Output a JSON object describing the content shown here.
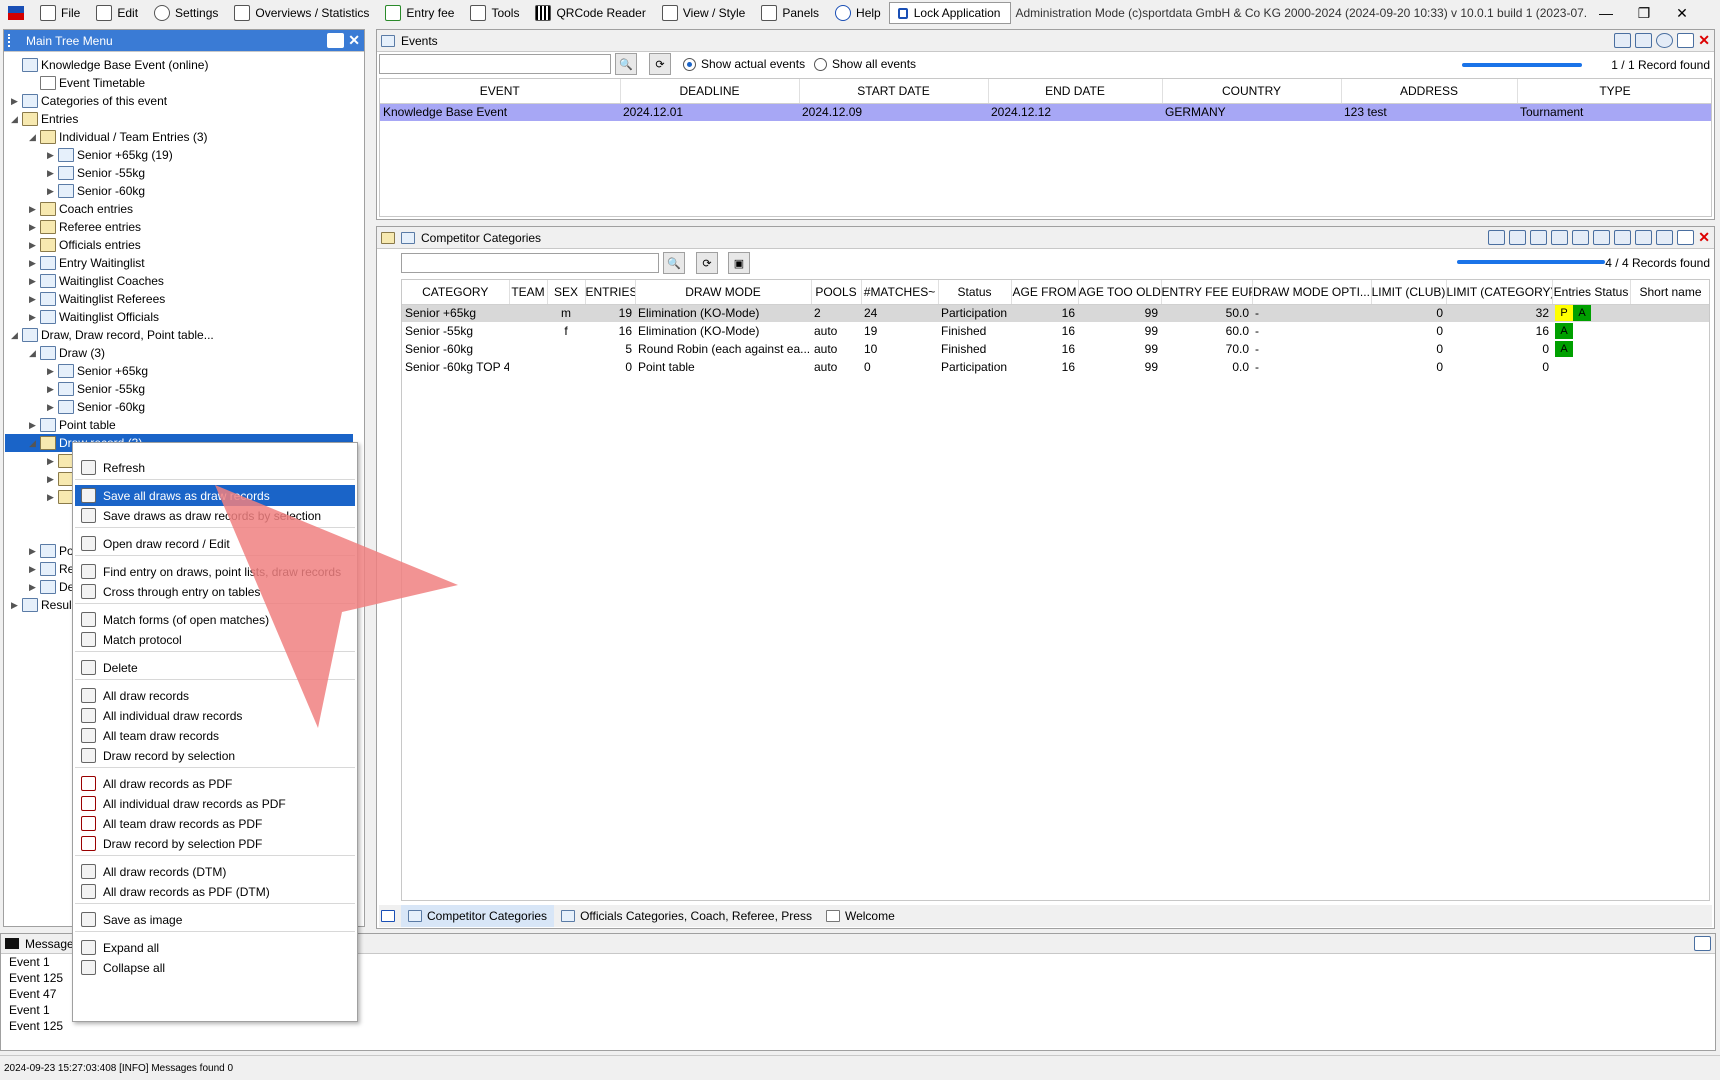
{
  "menubar": {
    "items": [
      {
        "label": "File",
        "icon": "file-icon"
      },
      {
        "label": "Edit",
        "icon": "edit-icon"
      },
      {
        "label": "Settings",
        "icon": "gear-icon"
      },
      {
        "label": "Overviews / Statistics",
        "icon": "overview-icon"
      },
      {
        "label": "Entry fee",
        "icon": "fee-icon"
      },
      {
        "label": "Tools",
        "icon": "tools-icon"
      },
      {
        "label": "QRCode Reader",
        "icon": "qrcode-icon"
      },
      {
        "label": "View / Style",
        "icon": "view-icon"
      },
      {
        "label": "Panels",
        "icon": "panels-icon"
      },
      {
        "label": "Help",
        "icon": "help-icon"
      }
    ],
    "lock_label": "Lock Application",
    "app_title": "Administration Mode (c)sportdata GmbH & Co KG 2000-2024 (2024-09-20 10:33)  v 10.0.1 build 1 (2023-07..."
  },
  "tree": {
    "title": "Main Tree Menu",
    "items": [
      {
        "label": "Knowledge Base Event (online)"
      },
      {
        "label": "Event Timetable"
      },
      {
        "label": "Categories of this event"
      },
      {
        "label": "Entries"
      },
      {
        "label": "Individual / Team Entries (3)"
      },
      {
        "label": "Senior +65kg (19)"
      },
      {
        "label": "Senior -55kg"
      },
      {
        "label": "Senior -60kg"
      },
      {
        "label": "Coach entries"
      },
      {
        "label": "Referee entries"
      },
      {
        "label": "Officials entries"
      },
      {
        "label": "Entry Waitinglist"
      },
      {
        "label": "Waitinglist Coaches"
      },
      {
        "label": "Waitinglist Referees"
      },
      {
        "label": "Waitinglist Officials"
      },
      {
        "label": "Draw, Draw record, Point table..."
      },
      {
        "label": "Draw (3)"
      },
      {
        "label": "Senior +65kg"
      },
      {
        "label": "Senior -55kg"
      },
      {
        "label": "Senior -60kg"
      },
      {
        "label": "Point table"
      },
      {
        "label": "Draw record (3)"
      },
      {
        "label": "Po"
      },
      {
        "label": "Re"
      },
      {
        "label": "De"
      },
      {
        "label": "Resul"
      }
    ]
  },
  "events": {
    "title": "Events",
    "radio_actual": "Show actual events",
    "radio_all": "Show all events",
    "records_found": "1 / 1 Record found",
    "columns": [
      "EVENT",
      "DEADLINE",
      "START DATE",
      "END DATE",
      "COUNTRY",
      "ADDRESS",
      "TYPE"
    ],
    "rows": [
      [
        "Knowledge Base Event",
        "2024.12.01",
        "2024.12.09",
        "2024.12.12",
        "GERMANY",
        "123 test",
        "Tournament"
      ]
    ]
  },
  "categories": {
    "title": "Competitor Categories",
    "records_found": "4 / 4 Records found",
    "columns": [
      "CATEGORY",
      "TEAM",
      "SEX",
      "ENTRIES",
      "DRAW MODE",
      "POOLS",
      "#MATCHES~",
      "Status",
      "AGE FROM",
      "AGE TOO OLD",
      "ENTRY FEE EUR",
      "DRAW MODE OPTI...",
      "LIMIT (CLUB)",
      "LIMIT (CATEGORY)",
      "Entries Status",
      "Short name"
    ],
    "rows": [
      {
        "category": "Senior +65kg",
        "team": "",
        "sex": "m",
        "entries": "19",
        "draw_mode": "Elimination (KO-Mode)",
        "pools": "2",
        "matches": "24",
        "status": "Participation",
        "age_from": "16",
        "age_too_old": "99",
        "fee": "50.0",
        "draw_opt": "-",
        "limit_club": "0",
        "limit_cat": "32",
        "badges": [
          "P",
          "A"
        ]
      },
      {
        "category": "Senior -55kg",
        "team": "",
        "sex": "f",
        "entries": "16",
        "draw_mode": "Elimination (KO-Mode)",
        "pools": "auto",
        "matches": "19",
        "status": "Finished",
        "age_from": "16",
        "age_too_old": "99",
        "fee": "60.0",
        "draw_opt": "-",
        "limit_club": "0",
        "limit_cat": "16",
        "badges": [
          "A"
        ]
      },
      {
        "category": "Senior -60kg",
        "team": "",
        "sex": "",
        "entries": "5",
        "draw_mode": "Round Robin (each against ea...",
        "pools": "auto",
        "matches": "10",
        "status": "Finished",
        "age_from": "16",
        "age_too_old": "99",
        "fee": "70.0",
        "draw_opt": "-",
        "limit_club": "0",
        "limit_cat": "0",
        "badges": [
          "A"
        ]
      },
      {
        "category": "Senior -60kg TOP 4",
        "team": "",
        "sex": "",
        "entries": "0",
        "draw_mode": "Point table",
        "pools": "auto",
        "matches": "0",
        "status": "Participation",
        "age_from": "16",
        "age_too_old": "99",
        "fee": "0.0",
        "draw_opt": "-",
        "limit_club": "0",
        "limit_cat": "0",
        "badges": []
      }
    ],
    "tabs": [
      "Competitor Categories",
      "Officials Categories, Coach, Referee, Press",
      "Welcome"
    ]
  },
  "context_menu": {
    "items": [
      {
        "label": "Refresh"
      },
      {
        "label": "Save all draws as draw records"
      },
      {
        "label": "Save draws as draw records by selection"
      },
      {
        "label": "Open draw record / Edit"
      },
      {
        "label": "Find entry on draws, point lists, draw records"
      },
      {
        "label": "Cross through entry on tables"
      },
      {
        "label": "Match forms (of open matches)"
      },
      {
        "label": "Match protocol"
      },
      {
        "label": "Delete"
      },
      {
        "label": "All draw records"
      },
      {
        "label": "All individual draw records"
      },
      {
        "label": "All team draw records"
      },
      {
        "label": "Draw record by selection"
      },
      {
        "label": "All draw records as PDF"
      },
      {
        "label": "All individual draw records as PDF"
      },
      {
        "label": "All team draw records as PDF"
      },
      {
        "label": "Draw record by selection PDF"
      },
      {
        "label": "All draw records (DTM)"
      },
      {
        "label": "All draw records as PDF (DTM)"
      },
      {
        "label": "Save as image"
      },
      {
        "label": "Expand all"
      },
      {
        "label": "Collapse all"
      }
    ]
  },
  "messages": {
    "title": "Message",
    "items": [
      "Event 1",
      "Event 125",
      "Event 47",
      "Event 1",
      "Event 125"
    ]
  },
  "status_bar": "2024-09-23 15:27:03:408 [INFO] Messages found 0",
  "colors": {
    "selection": "#1a64c8",
    "row_highlight": "#a7a7f5",
    "arrow": "#f08080",
    "badge_p": "#ffff00",
    "badge_a": "#00a000"
  }
}
